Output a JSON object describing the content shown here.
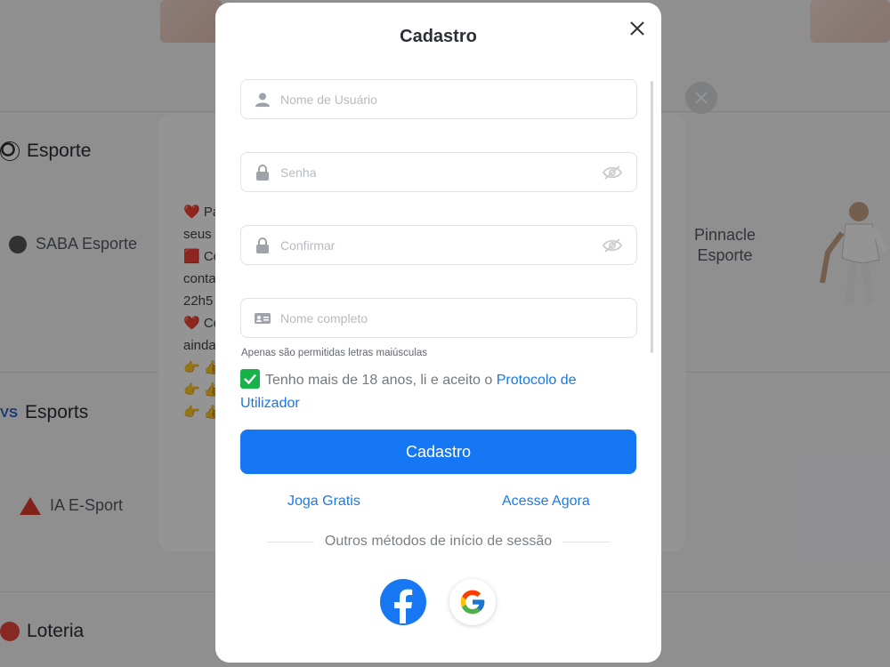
{
  "background": {
    "sections": [
      {
        "title": "Esporte",
        "icon": "soccer-ball-icon"
      },
      {
        "title": "Esports",
        "icon": "versus-icon"
      },
      {
        "title": "Loteria",
        "icon": "lottery-ball-icon"
      }
    ],
    "items": {
      "saba": "SABA Esporte",
      "ia": "IA E-Sport",
      "pinnacle_line1": "Pinnacle",
      "pinnacle_line2": "Esporte"
    },
    "popup_lines": [
      "❤️ Pa",
      "seus",
      "🟥 Co",
      "conta",
      "22h5",
      "❤️ Co",
      "ainda",
      "👉 👍",
      "👉 👍",
      "👉 👍"
    ]
  },
  "modal": {
    "title": "Cadastro",
    "fields": {
      "username_placeholder": "Nome de Usuário",
      "password_placeholder": "Senha",
      "confirm_placeholder": "Confirmar",
      "fullname_placeholder": "Nome completo"
    },
    "hint": "Apenas são permitidas letras maiúsculas",
    "agree_text": "Tenho mais de 18 anos, li e aceito o ",
    "agree_link": "Protocolo de Utilizador",
    "agree_checked": true,
    "submit_label": "Cadastro",
    "link_free": "Joga Gratis",
    "link_access": "Acesse Agora",
    "divider_text": "Outros métodos de início de sessão",
    "social": [
      "facebook-icon",
      "google-icon"
    ]
  },
  "colors": {
    "primary": "#1677f5",
    "link": "#1e7ae6",
    "checkbox": "#17b34a"
  }
}
